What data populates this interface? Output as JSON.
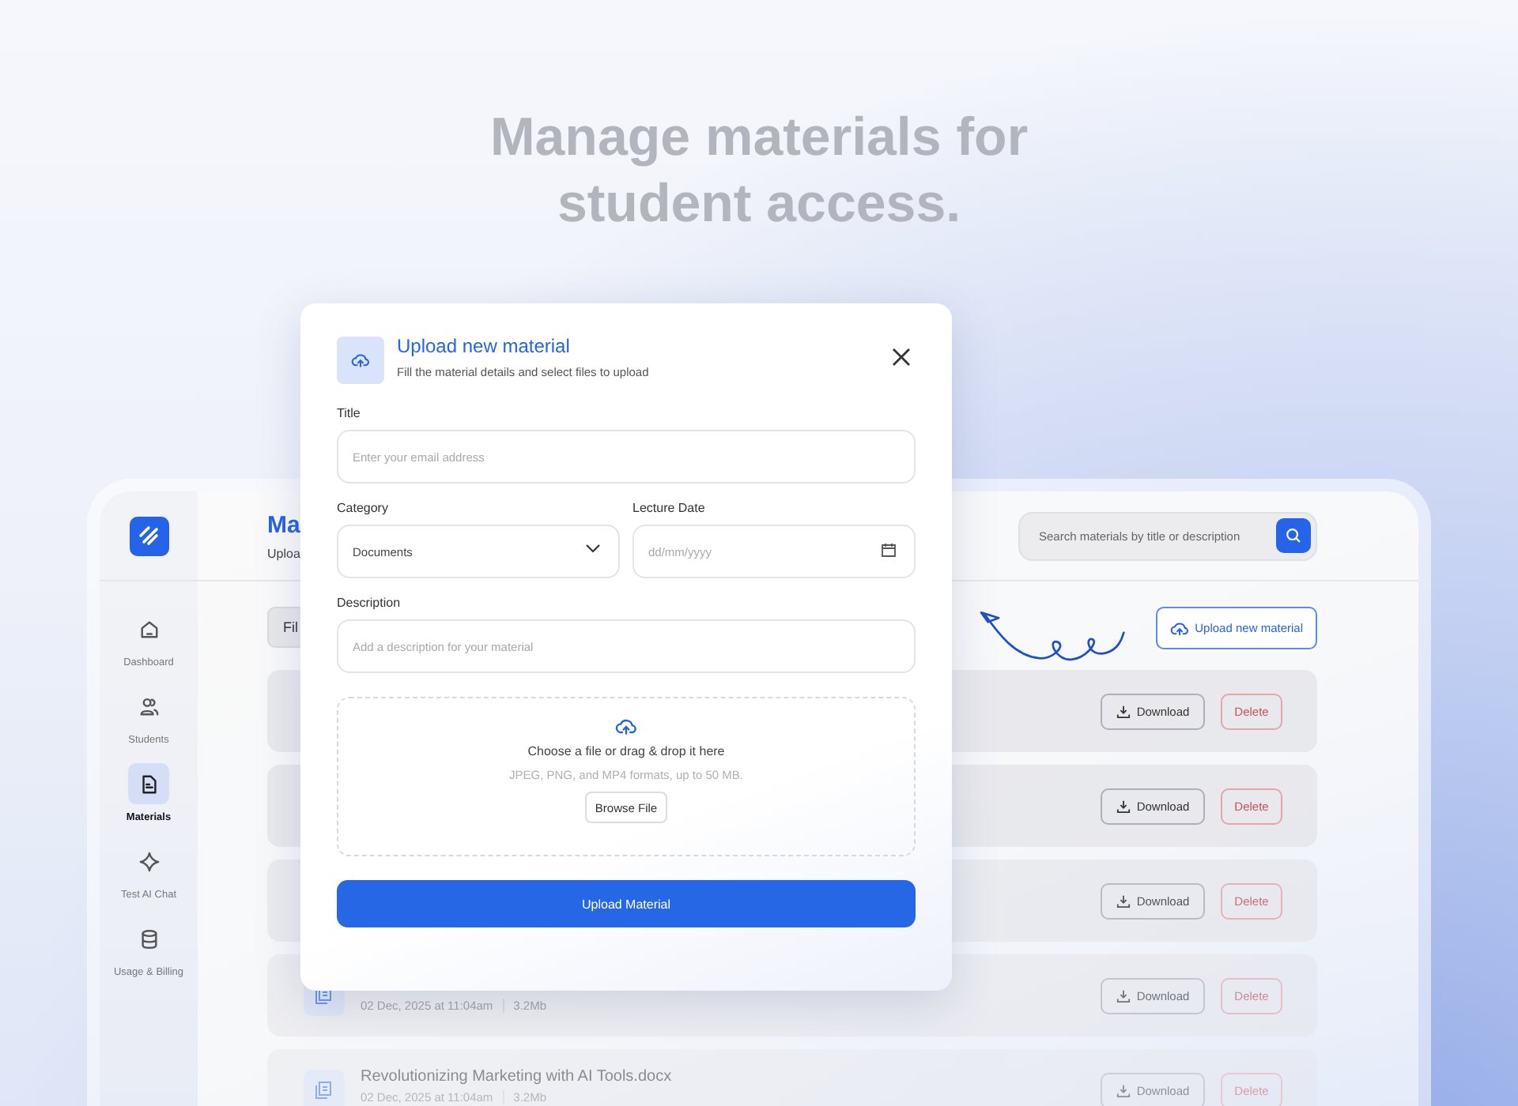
{
  "headline": "Manage materials for student access.",
  "sidebar": {
    "items": [
      {
        "label": "Dashboard",
        "selected": false
      },
      {
        "label": "Students",
        "selected": false
      },
      {
        "label": "Materials",
        "selected": true
      },
      {
        "label": "Test AI Chat",
        "selected": false
      },
      {
        "label": "Usage & Billing",
        "selected": false
      }
    ]
  },
  "header": {
    "title": "Ma",
    "subtitle": "Uploa",
    "search": {
      "placeholder": "Search materials by title or description"
    }
  },
  "toolbar": {
    "filter": "Fil",
    "upload_button": "Upload new material"
  },
  "materials": [
    {
      "download": "Download",
      "delete": "Delete"
    },
    {
      "download": "Download",
      "delete": "Delete"
    },
    {
      "download": "Download",
      "delete": "Delete"
    },
    {
      "date": "02 Dec, 2025 at 11:04am",
      "size": "3.2Mb",
      "download": "Download",
      "delete": "Delete"
    },
    {
      "title": "Revolutionizing Marketing with AI Tools.docx",
      "date": "02 Dec, 2025 at 11:04am",
      "size": "3.2Mb",
      "download": "Download",
      "delete": "Delete"
    }
  ],
  "modal": {
    "title": "Upload new material",
    "subtitle": "Fill the material details and select files to upload",
    "fields": [
      {
        "kind": "text",
        "label": "Title",
        "placeholder": "Enter your email address"
      },
      {
        "kind": "select",
        "label": "Category",
        "value": "Documents"
      },
      {
        "kind": "date",
        "label": "Lecture Date",
        "placeholder": "dd/mm/yyyy"
      },
      {
        "kind": "text",
        "label": "Description",
        "placeholder": "Add a description for your material"
      }
    ],
    "dropzone": {
      "prompt": "Choose a file or drag & drop it here",
      "hint": "JPEG, PNG, and MP4 formats, up to 50 MB.",
      "browse": "Browse File"
    },
    "submit": "Upload Material"
  }
}
